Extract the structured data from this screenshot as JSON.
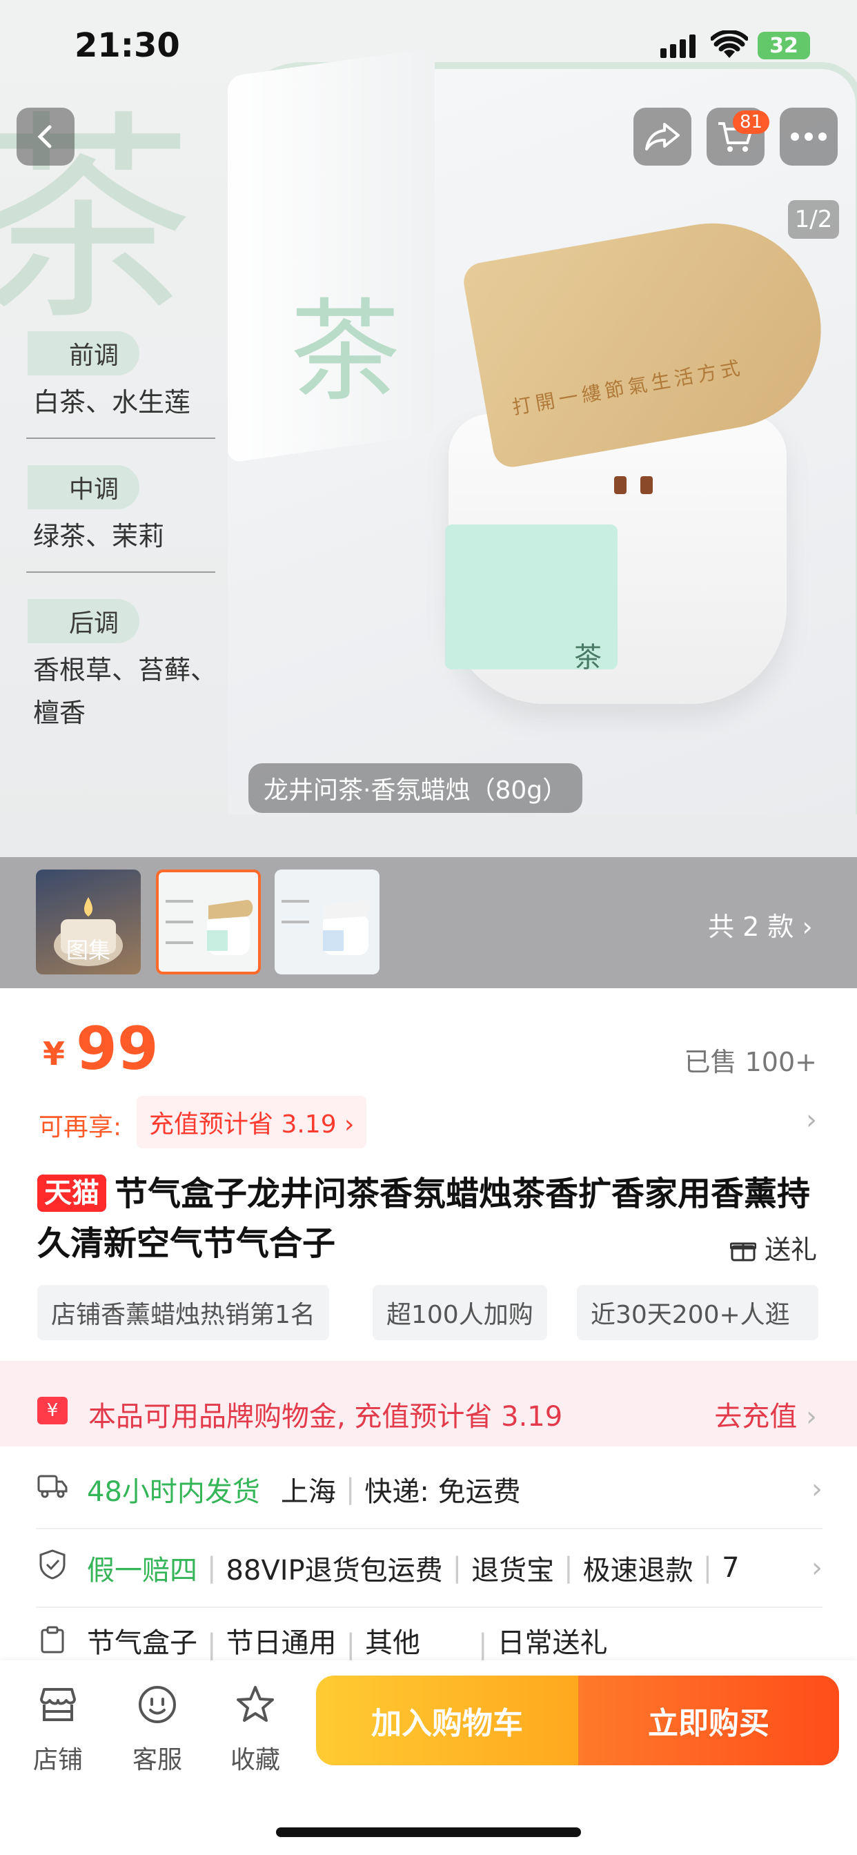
{
  "status": {
    "time": "21:30",
    "battery": "32"
  },
  "top": {
    "cart_count": "81",
    "pager": "1/2"
  },
  "hero": {
    "big_char": "茶",
    "box_char": "茶",
    "label_char": "茶",
    "lid_text": "打開一縷節氣生活方式",
    "notes": [
      {
        "name": "前调",
        "text": "白茶、水生莲"
      },
      {
        "name": "中调",
        "text": "绿茶、茉莉"
      },
      {
        "name": "后调",
        "text": "香根草、苔藓、檀香"
      }
    ],
    "caption": "龙井问茶·香氛蜡烛（80g）"
  },
  "thumbs": {
    "gallery_label": "图集",
    "count_label": "共 2 款"
  },
  "product": {
    "currency": "¥",
    "price": "99",
    "sold": "已售 100+",
    "enjoy_label": "可再享:",
    "recharge_tag": "充值预计省 3.19 ›",
    "tmall": "天猫",
    "title": "节气盒子龙井问茶香氛蜡烛茶香扩香家用香薰持久清新空气节气合子",
    "gift": "送礼",
    "tags": [
      "店铺香薰蜡烛热销第1名",
      "超100人加购",
      "近30天200+人逛"
    ]
  },
  "promo": {
    "icon": "¥",
    "text": "本品可用品牌购物金, 充值预计省 3.19",
    "action": "去充值"
  },
  "rows": {
    "shipping": {
      "speed": "48小时内发货",
      "from": "上海",
      "express": "快递: 免运费"
    },
    "guarantee": {
      "main": "假一赔四",
      "items": [
        "88VIP退货包运费",
        "退货宝",
        "极速退款",
        "7"
      ]
    },
    "params": {
      "items": [
        "节气盒子",
        "节日通用",
        "其他",
        "日常送礼"
      ]
    }
  },
  "bottom": {
    "shop": "店铺",
    "service": "客服",
    "favorite": "收藏",
    "add_cart": "加入购物车",
    "buy_now": "立即购买"
  }
}
